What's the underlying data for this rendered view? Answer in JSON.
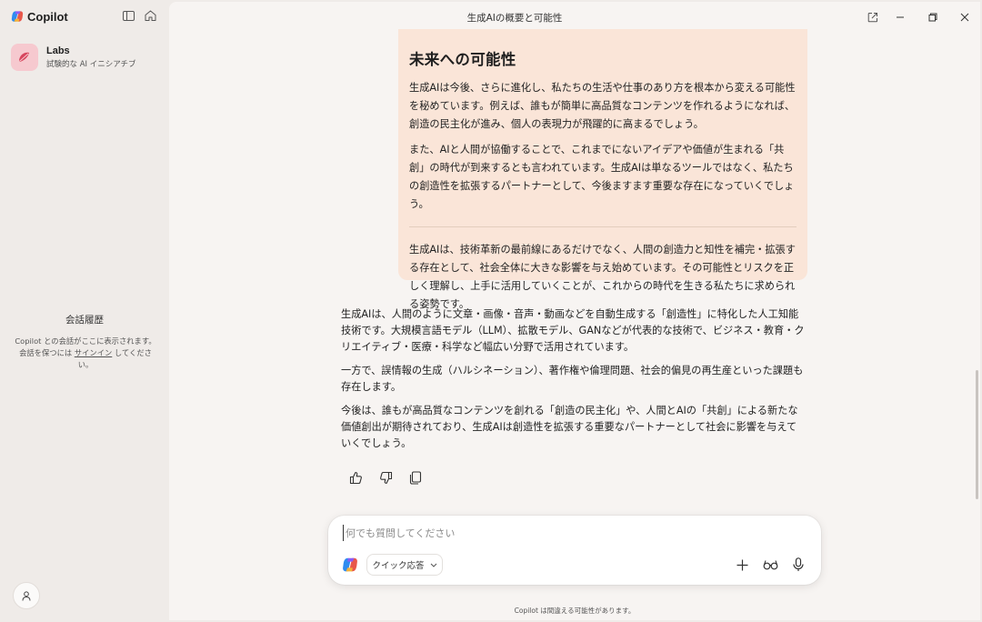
{
  "app": {
    "brand": "Copilot",
    "conversation_title": "生成AIの概要と可能性"
  },
  "sidebar": {
    "labs_title": "Labs",
    "labs_subtitle": "試験的な AI イニシアチブ",
    "history_title": "会話履歴",
    "history_desc_before": "Copilot との会話がここに表示されます。会話を保つには ",
    "history_desc_link": "サインイン",
    "history_desc_after": " してください。"
  },
  "bubble": {
    "heading": "未来への可能性",
    "para1": "生成AIは今後、さらに進化し、私たちの生活や仕事のあり方を根本から変える可能性を秘めています。例えば、誰もが簡単に高品質なコンテンツを作れるようになれば、創造の民主化が進み、個人の表現力が飛躍的に高まるでしょう。",
    "para2": "また、AIと人間が協働することで、これまでにないアイデアや価値が生まれる「共創」の時代が到来するとも言われています。生成AIは単なるツールではなく、私たちの創造性を拡張するパートナーとして、今後ますます重要な存在になっていくでしょう。",
    "para3": "生成AIは、技術革新の最前線にあるだけでなく、人間の創造力と知性を補完・拡張する存在として、社会全体に大きな影響を与え始めています。その可能性とリスクを正しく理解し、上手に活用していくことが、これからの時代を生きる私たちに求められる姿勢です。"
  },
  "answer": {
    "para1": "生成AIは、人間のように文章・画像・音声・動画などを自動生成する「創造性」に特化した人工知能技術です。大規模言語モデル（LLM）、拡散モデル、GANなどが代表的な技術で、ビジネス・教育・クリエイティブ・医療・科学など幅広い分野で活用されています。",
    "para2": "一方で、誤情報の生成（ハルシネーション）、著作権や倫理問題、社会的偏見の再生産といった課題も存在します。",
    "para3": "今後は、誰もが高品質なコンテンツを創れる「創造の民主化」や、人間とAIの「共創」による新たな価値創出が期待されており、生成AIは創造性を拡張する重要なパートナーとして社会に影響を与えていくでしょう。"
  },
  "composer": {
    "placeholder": "何でも質問してください",
    "value": "",
    "mode_label": "クイック応答"
  },
  "footer": {
    "disclaimer": "Copilot は間違える可能性があります。"
  },
  "colors": {
    "sidebar_bg": "#efebe8",
    "main_bg": "#f7f4f2",
    "bubble_bg": "#fae5d8",
    "labs_icon_bg": "#f6c9cf"
  }
}
